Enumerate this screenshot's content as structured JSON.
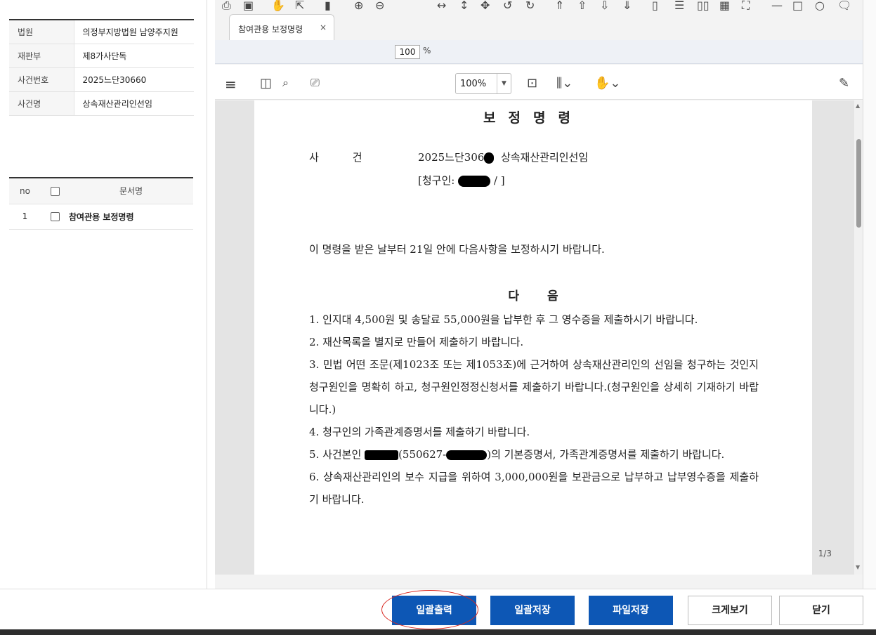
{
  "case_info": {
    "rows": [
      {
        "label": "법원",
        "value": "의정부지방법원 남양주지원"
      },
      {
        "label": "재판부",
        "value": "제8가사단독"
      },
      {
        "label": "사건번호",
        "value": "2025느단30660"
      },
      {
        "label": "사건명",
        "value": "상속재산관리인선임"
      }
    ]
  },
  "doc_list": {
    "headers": {
      "no": "no",
      "title": "문서명"
    },
    "rows": [
      {
        "no": "1",
        "title": "참여관용 보정명령"
      }
    ]
  },
  "viewer": {
    "tab_label": "참여관용 보정명령",
    "tab_close": "×",
    "toolbar_zoom_value": "100",
    "toolbar_zoom_unit": "%",
    "zoom_select": "100%",
    "page_indicator": "1/3"
  },
  "document": {
    "heading": "보정명령",
    "case_label": "사건",
    "case_number": "2025느단306",
    "case_name": "상속재산관리인선임",
    "claimant_prefix": "[청구인:",
    "claimant_suffix": "/ ]",
    "lead": "이 명령을 받은 날부터 21일 안에 다음사항을 보정하시기 바랍니다.",
    "da": "다음",
    "items": [
      "1. 인지대 4,500원 및 송달료 55,000원을 납부한 후 그 영수증을 제출하시기 바랍니다.",
      "2. 재산목록을 별지로 만들어 제출하기 바랍니다.",
      "3. 민법 어떤 조문(제1023조 또는 제1053조)에 근거하여 상속재산관리인의 선임을 청구하는 것인지 청구원인을 명확히 하고, 청구원인정정신청서를 제출하기 바랍니다.(청구원인을 상세히 기재하기 바랍니다.)",
      "4. 청구인의 가족관계증명서를 제출하기 바랍니다."
    ],
    "item5_prefix": "5. 사건본인",
    "item5_mid": "(550627-",
    "item5_suffix": ")의 기본증명서, 가족관계증명서를 제출하기 바랍니다.",
    "item6": "6. 상속재산관리인의 보수 지급을 위하여 3,000,000원을 보관금으로 납부하고 납부영수증을 제출하기 바랍니다."
  },
  "buttons": {
    "print_all": "일괄출력",
    "save_all": "일괄저장",
    "save_file": "파일저장",
    "enlarge": "크게보기",
    "close": "닫기"
  },
  "colors": {
    "primary": "#0d57b5",
    "annotation": "#d9271f"
  }
}
